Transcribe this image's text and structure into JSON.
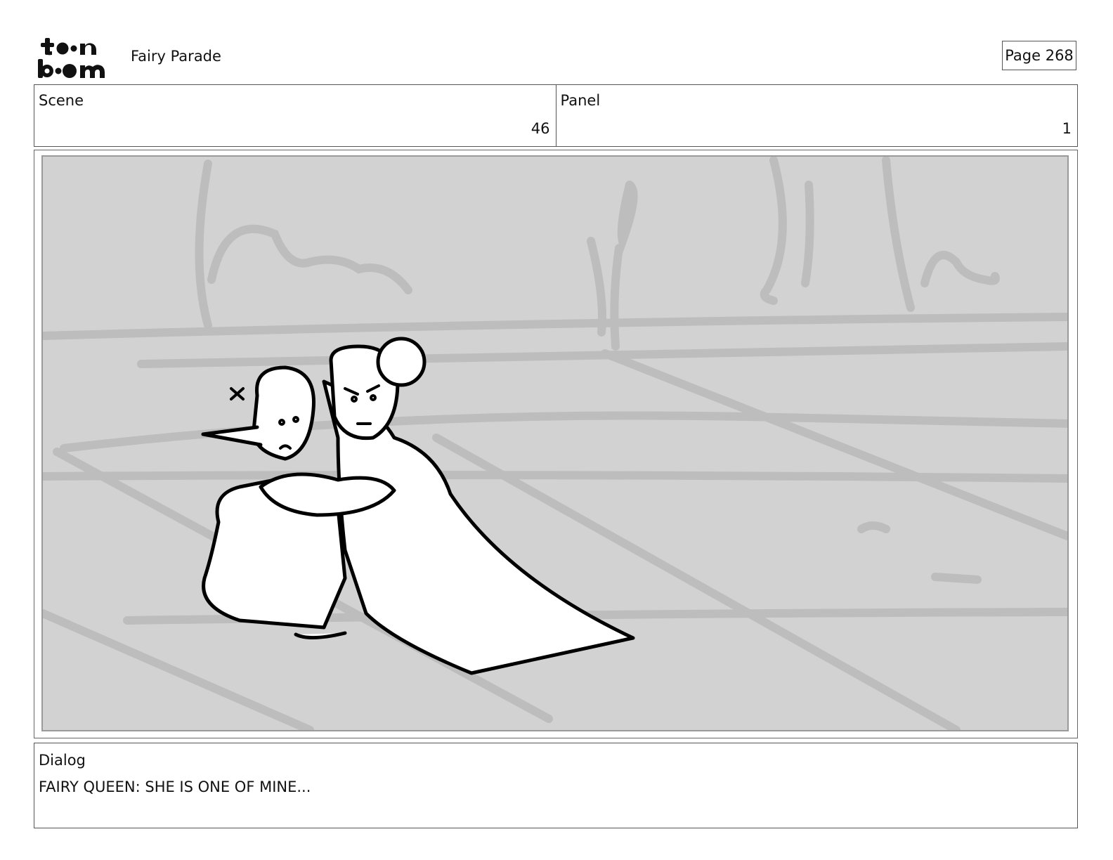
{
  "header": {
    "logo_text": "toon boom",
    "project_title": "Fairy Parade",
    "page_label": "Page 268"
  },
  "info": {
    "scene_label": "Scene",
    "scene_value": "46",
    "panel_label": "Panel",
    "panel_value": "1"
  },
  "panel_image": {
    "description_icon": "storyboard-sketch-image"
  },
  "dialog": {
    "label": "Dialog",
    "text": "FAIRY QUEEN: SHE IS ONE OF MINE..."
  }
}
